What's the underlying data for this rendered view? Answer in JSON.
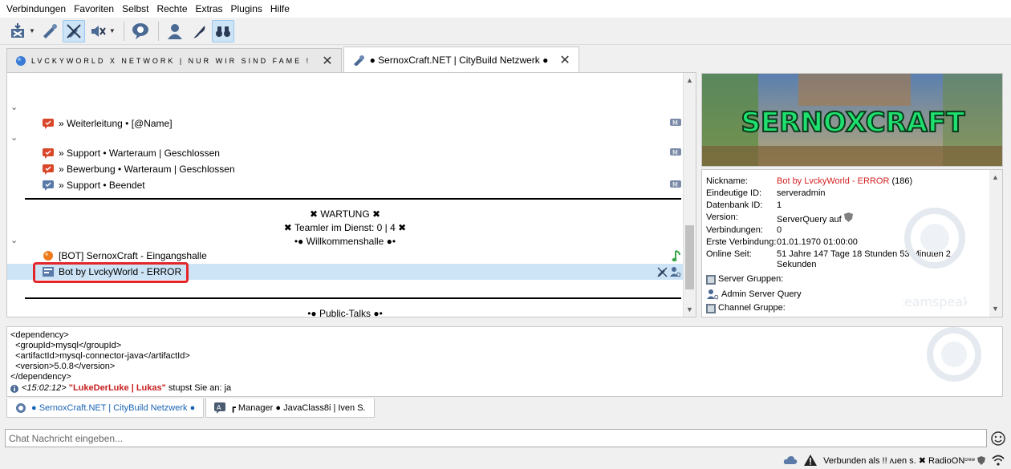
{
  "menu": [
    "Verbindungen",
    "Favoriten",
    "Selbst",
    "Rechte",
    "Extras",
    "Plugins",
    "Hilfe"
  ],
  "server_tabs": [
    {
      "label": "LVCKYWORLD X NETWORK | NUR WIR SIND FAME !"
    },
    {
      "label": "● SernoxCraft.NET | CityBuild Netzwerk ●"
    }
  ],
  "tree": {
    "ch_weiterleitung": "» Weiterleitung • [@Name]",
    "ch_support_warte": "» Support • Warteraum | Geschlossen",
    "ch_bewerbung": "» Bewerbung • Warteraum | Geschlossen",
    "ch_support_beendet": "» Support • Beendet",
    "wartung": "✖  WARTUNG  ✖",
    "teamler": "✖ Teamler im Dienst: 0 | 4  ✖",
    "willkommenshalle": "•● Willkommenshalle ●•",
    "ch_eingangshalle": "[BOT] SernoxCraft - Eingangshalle",
    "client_bot": "Bot by LvckyWorld - ERROR",
    "public_talks": "•● Public-Talks ●•"
  },
  "banner": {
    "text": "SERNOXCRAFT"
  },
  "info": {
    "nickname_label": "Nickname:",
    "nickname_value": "Bot by LvckyWorld - ERROR",
    "nickname_id": "(186)",
    "uid_label": "Eindeutige ID:",
    "uid_value": "serveradmin",
    "dbid_label": "Datenbank ID:",
    "dbid_value": "1",
    "version_label": "Version:",
    "version_value": "ServerQuery auf",
    "connections_label": "Verbindungen:",
    "connections_value": "0",
    "first_conn_label": "Erste Verbindung:",
    "first_conn_value": "01.01.1970 01:00:00",
    "online_label": "Online Seit:",
    "online_value": "51 Jahre 147 Tage 18 Stunden 53 Minuten 2 Sekunden",
    "server_groups_label": "Server Gruppen:",
    "server_group_1": "Admin Server Query",
    "channel_group_label": "Channel Gruppe:",
    "watermark": "teamspeak"
  },
  "chatlog": {
    "lines": [
      "<dependency>",
      "  <groupId>mysql</groupId>",
      "  <artifactId>mysql-connector-java</artifactId>",
      "  <version>5.0.8</version>",
      "</dependency>"
    ],
    "time": "<15:02:12>",
    "nick": "\"LukeDerLuke | Lukas\"",
    "action": "stupst Sie an: ja"
  },
  "chat_tabs": [
    {
      "label": "● SernoxCraft.NET | CityBuild Netzwerk ●"
    },
    {
      "label": "┏ Manager ● JavaClass8i | Iven S."
    }
  ],
  "chat_input": {
    "placeholder": "Chat Nachricht eingeben..."
  },
  "status": {
    "text": "Verbunden als !! ʌɹen s. ✖ RadioON",
    "sup": "crew"
  },
  "colors": {
    "selected": "#cde4f7",
    "highlight": "#e3262a",
    "error": "#d42020",
    "link": "#1a64b4"
  }
}
